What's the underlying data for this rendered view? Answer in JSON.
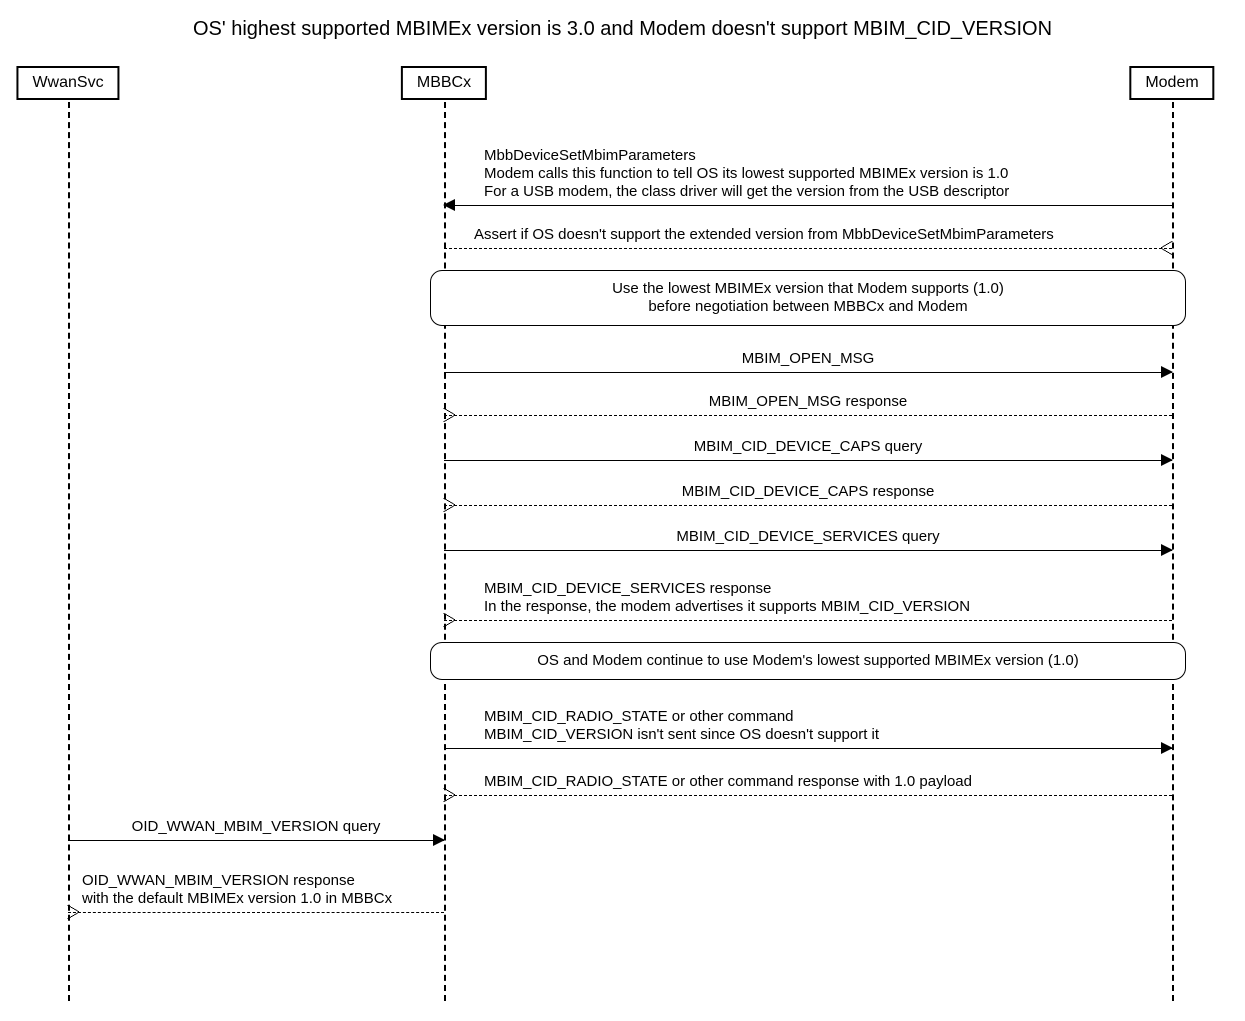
{
  "title": "OS' highest supported MBIMEx version is 3.0 and Modem doesn't support MBIM_CID_VERSION",
  "actors": {
    "wwansvc": "WwanSvc",
    "mbbcx": "MBBCx",
    "modem": "Modem"
  },
  "messages": {
    "m1": "MbbDeviceSetMbimParameters\nModem calls this function to tell OS its lowest supported MBIMEx version is 1.0\nFor a USB modem, the class driver will get the version from the USB descriptor",
    "m2": "Assert if OS doesn't support the extended version from MbbDeviceSetMbimParameters",
    "m3": "MBIM_OPEN_MSG",
    "m4": "MBIM_OPEN_MSG response",
    "m5": "MBIM_CID_DEVICE_CAPS query",
    "m6": "MBIM_CID_DEVICE_CAPS response",
    "m7": "MBIM_CID_DEVICE_SERVICES query",
    "m8": "MBIM_CID_DEVICE_SERVICES response\nIn the response, the modem advertises it supports MBIM_CID_VERSION",
    "m9": "MBIM_CID_RADIO_STATE or other command\nMBIM_CID_VERSION isn't sent since OS doesn't support it",
    "m10": "MBIM_CID_RADIO_STATE or other command response with 1.0 payload",
    "m11": "OID_WWAN_MBIM_VERSION query",
    "m12": "OID_WWAN_MBIM_VERSION response\nwith the default MBIMEx version 1.0 in MBBCx"
  },
  "notes": {
    "n1": "Use the lowest MBIMEx version that Modem supports (1.0)\nbefore negotiation between MBBCx and Modem",
    "n2": "OS and Modem continue to use Modem's lowest supported MBIMEx version (1.0)"
  },
  "chart_data": {
    "type": "sequence-diagram",
    "title": "OS' highest supported MBIMEx version is 3.0 and Modem doesn't support MBIM_CID_VERSION",
    "participants": [
      "WwanSvc",
      "MBBCx",
      "Modem"
    ],
    "events": [
      {
        "kind": "message",
        "from": "Modem",
        "to": "MBBCx",
        "style": "solid",
        "text": "MbbDeviceSetMbimParameters — Modem calls this function to tell OS its lowest supported MBIMEx version is 1.0. For a USB modem, the class driver will get the version from the USB descriptor"
      },
      {
        "kind": "message",
        "from": "MBBCx",
        "to": "Modem",
        "style": "dashed",
        "text": "Assert if OS doesn't support the extended version from MbbDeviceSetMbimParameters"
      },
      {
        "kind": "note",
        "over": [
          "MBBCx",
          "Modem"
        ],
        "text": "Use the lowest MBIMEx version that Modem supports (1.0) before negotiation between MBBCx and Modem"
      },
      {
        "kind": "message",
        "from": "MBBCx",
        "to": "Modem",
        "style": "solid",
        "text": "MBIM_OPEN_MSG"
      },
      {
        "kind": "message",
        "from": "Modem",
        "to": "MBBCx",
        "style": "dashed",
        "text": "MBIM_OPEN_MSG response"
      },
      {
        "kind": "message",
        "from": "MBBCx",
        "to": "Modem",
        "style": "solid",
        "text": "MBIM_CID_DEVICE_CAPS query"
      },
      {
        "kind": "message",
        "from": "Modem",
        "to": "MBBCx",
        "style": "dashed",
        "text": "MBIM_CID_DEVICE_CAPS response"
      },
      {
        "kind": "message",
        "from": "MBBCx",
        "to": "Modem",
        "style": "solid",
        "text": "MBIM_CID_DEVICE_SERVICES query"
      },
      {
        "kind": "message",
        "from": "Modem",
        "to": "MBBCx",
        "style": "dashed",
        "text": "MBIM_CID_DEVICE_SERVICES response — In the response, the modem advertises it supports MBIM_CID_VERSION"
      },
      {
        "kind": "note",
        "over": [
          "MBBCx",
          "Modem"
        ],
        "text": "OS and Modem continue to use Modem's lowest supported MBIMEx version (1.0)"
      },
      {
        "kind": "message",
        "from": "MBBCx",
        "to": "Modem",
        "style": "solid",
        "text": "MBIM_CID_RADIO_STATE or other command — MBIM_CID_VERSION isn't sent since OS doesn't support it"
      },
      {
        "kind": "message",
        "from": "Modem",
        "to": "MBBCx",
        "style": "dashed",
        "text": "MBIM_CID_RADIO_STATE or other command response with 1.0 payload"
      },
      {
        "kind": "message",
        "from": "WwanSvc",
        "to": "MBBCx",
        "style": "solid",
        "text": "OID_WWAN_MBIM_VERSION query"
      },
      {
        "kind": "message",
        "from": "MBBCx",
        "to": "WwanSvc",
        "style": "dashed",
        "text": "OID_WWAN_MBIM_VERSION response with the default MBIMEx version 1.0 in MBBCx"
      }
    ]
  }
}
